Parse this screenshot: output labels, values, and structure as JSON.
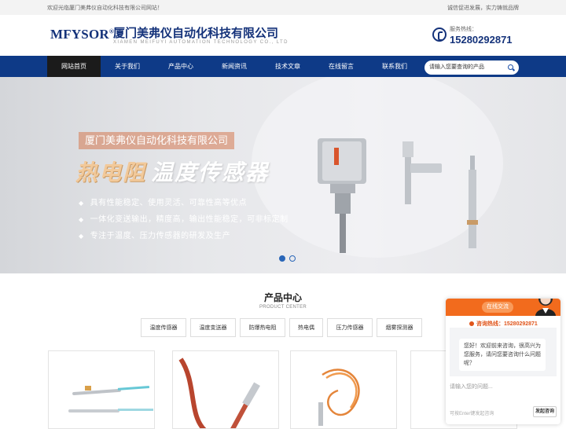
{
  "topbar": {
    "welcome": "欢迎光临厦门美弗仪自动化科技有限公司网站！",
    "slogan": "诚信促进发展，实力铸就品牌"
  },
  "header": {
    "logo_mark": "MFYSOR",
    "logo_reg": "®",
    "company_cn": "厦门美弗仪自动化科技有限公司",
    "company_en": "XIAMEN MEIFUYI AUTOMATION TECHNOLOGY CO., LTD",
    "hotline_label": "服务热线：",
    "hotline_number": "15280292871"
  },
  "nav": {
    "items": [
      {
        "label": "网站首页",
        "active": true
      },
      {
        "label": "关于我们"
      },
      {
        "label": "产品中心"
      },
      {
        "label": "新闻资讯"
      },
      {
        "label": "技术文章"
      },
      {
        "label": "在线留言"
      },
      {
        "label": "联系我们"
      }
    ],
    "search_placeholder": "请输入您要查询的产品"
  },
  "banner": {
    "tag": "厦门美弗仪自动化科技有限公司",
    "headline_a": "热电阻",
    "headline_b": "温度传感器",
    "bullets": [
      "具有性能稳定、使用灵活、可靠性高等优点",
      "一体化变送输出，精度高，输出性能稳定，可非标定制",
      "专注于温度、压力传感器的研发及生产"
    ],
    "slide_count": 2,
    "active_slide": 1
  },
  "products": {
    "title": "产品中心",
    "subtitle": "PRODUCT CENTER",
    "categories": [
      "温度传感器",
      "温度变送器",
      "防爆热电阻",
      "热电偶",
      "压力传感器",
      "烟雾探测器"
    ]
  },
  "chat": {
    "header_label": "在线交流",
    "hotline": "咨询热线：15280292871",
    "message": "您好！欢迎前来咨询，很高兴为您服务，请问您要咨询什么问题呢？",
    "input_placeholder": "请输入您的问题...",
    "footer_hint": "可按Enter键发起咨询",
    "send_label": "发起咨询"
  },
  "colors": {
    "brand_blue": "#0e3a87",
    "accent_orange": "#f26b1d"
  }
}
